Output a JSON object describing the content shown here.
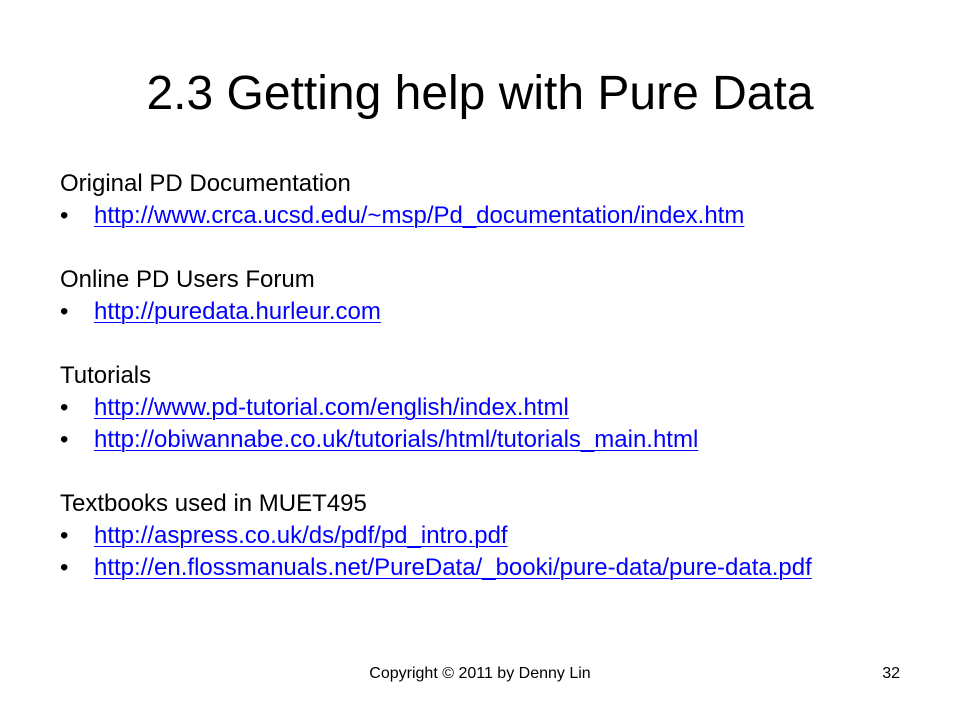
{
  "slide": {
    "title": "2.3 Getting help with Pure Data"
  },
  "sections": [
    {
      "heading": "Original PD Documentation",
      "links": [
        "http://www.crca.ucsd.edu/~msp/Pd_documentation/index.htm"
      ]
    },
    {
      "heading": "Online PD Users Forum",
      "links": [
        "http://puredata.hurleur.com"
      ]
    },
    {
      "heading": "Tutorials",
      "links": [
        "http://www.pd-tutorial.com/english/index.html",
        "http://obiwannabe.co.uk/tutorials/html/tutorials_main.html"
      ]
    },
    {
      "heading": "Textbooks used in MUET495",
      "links": [
        "http://aspress.co.uk/ds/pdf/pd_intro.pdf",
        "http://en.flossmanuals.net/PureData/_booki/pure-data/pure-data.pdf"
      ]
    }
  ],
  "bullet_glyph": "•",
  "footer": {
    "copyright": "Copyright © 2011 by Denny Lin",
    "page_number": "32"
  },
  "colors": {
    "link": "#0000ff",
    "text": "#000000",
    "background": "#ffffff"
  }
}
